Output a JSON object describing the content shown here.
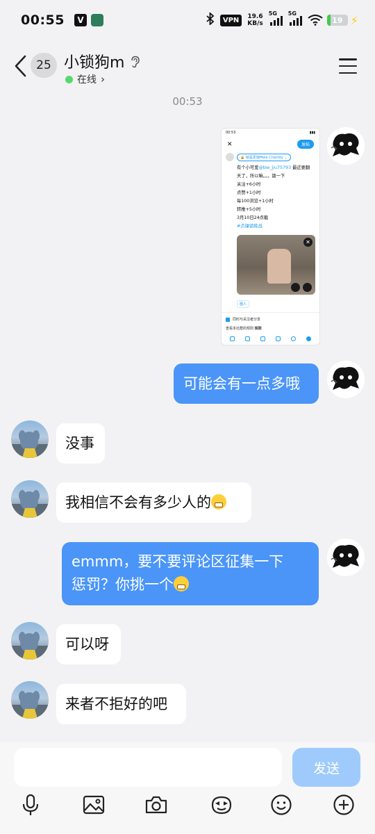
{
  "status_bar": {
    "time": "00:55",
    "notif_icon_1": "V",
    "speed_value": "19.6",
    "speed_unit": "KB/s",
    "vpn_label": "VPN",
    "sim1_label": "5G",
    "sim2_label": "5G",
    "battery_level": "19",
    "battery_fraction": 0.19,
    "battery_color": "#47c94d"
  },
  "header": {
    "unread_count": "25",
    "contact_name": "小锁狗m",
    "status_text": "在线"
  },
  "conversation": {
    "timestamp": "00:53",
    "shared_screenshot": {
      "status_time": "00:53",
      "post_button": "发帖",
      "audience": "🔒 就是爱锁Male Chastity ⌄",
      "lines": [
        "有个小可爱",
        "@bie_jiu75793",
        " 最近要翻",
        "天了，所以嘛。。。锁一下",
        "关注+6小时",
        "点赞+1小时",
        "每100浏览+1小时",
        "转推+5小时",
        "3月10日24点截",
        "#贞操锁挑战"
      ],
      "photo_tag": "+467",
      "tag_label": "圈人",
      "share_check": "同时与关注者分享",
      "rules_text": "查看本社群的规则",
      "rules_link": "规则"
    },
    "messages": [
      {
        "from": "me",
        "text": "可能会有一点多哦"
      },
      {
        "from": "other",
        "text": "没事"
      },
      {
        "from": "other",
        "text": "我相信不会有多少人的",
        "emoji": "grin"
      },
      {
        "from": "me",
        "text_line1": "emmm，要不要评论区征集一下",
        "text_line2": "惩罚？你挑一个",
        "emoji": "smirk"
      },
      {
        "from": "other",
        "text": "可以呀"
      },
      {
        "from": "other",
        "text": "来者不拒好的吧"
      }
    ]
  },
  "composer": {
    "input_value": "",
    "send_label": "发送",
    "send_color": "#9ecbfb"
  },
  "toolbar_icons": [
    "microphone-icon",
    "image-icon",
    "camera-icon",
    "sticker-icon",
    "emoji-icon",
    "plus-icon"
  ],
  "colors": {
    "accent": "#4a95f7",
    "background": "#f2f2f4"
  }
}
